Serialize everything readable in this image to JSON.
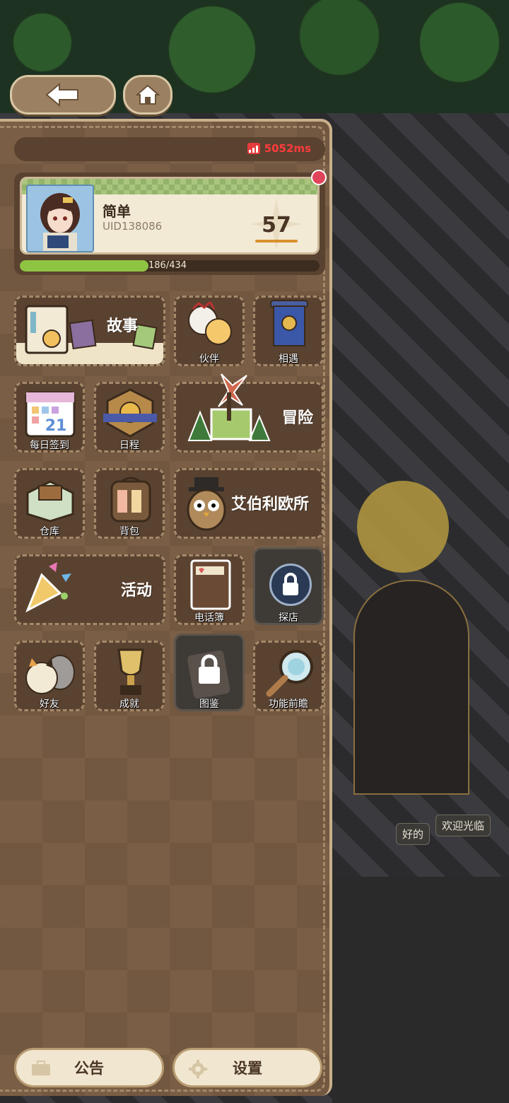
{
  "top_buttons": {
    "back": "back-arrow-icon",
    "home": "home-icon"
  },
  "ping": {
    "value": "5052ms",
    "color": "#ff3b3b"
  },
  "profile": {
    "name": "简单",
    "uid": "UID138086",
    "level": "57",
    "xp_text": "186/434",
    "xp_current": 186,
    "xp_max": 434
  },
  "tiles": {
    "story": "故事",
    "partner": "伙伴",
    "encounter": "相遇",
    "daily_signin": "每日签到",
    "daily_signin_date": "21",
    "schedule": "日程",
    "adventure": "冒险",
    "warehouse": "仓库",
    "backpack": "背包",
    "owl_office": "艾伯利欧所",
    "activity": "活动",
    "phonebook": "电话簿",
    "explore": "探店",
    "friends": "好友",
    "achievements": "成就",
    "encyclopedia": "图鉴",
    "feature_preview": "功能前瞻"
  },
  "bottom": {
    "notice": "公告",
    "settings": "设置"
  },
  "scene": {
    "bubble_ok": "好的",
    "bubble_welcome": "欢迎光临"
  }
}
